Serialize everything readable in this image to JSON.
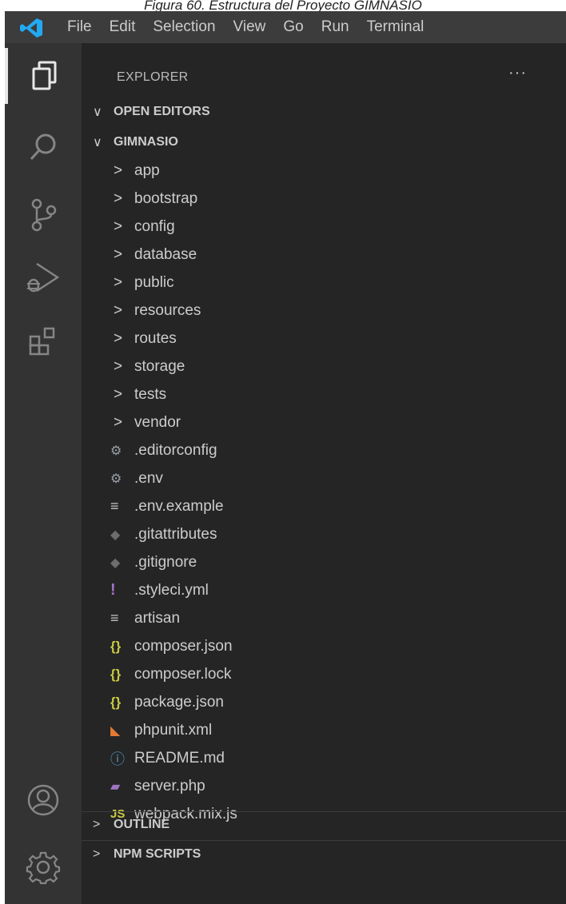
{
  "caption": "Figura 60. Estructura del Proyecto GIMNASIO",
  "menu": [
    "File",
    "Edit",
    "Selection",
    "View",
    "Go",
    "Run",
    "Terminal"
  ],
  "sidebar": {
    "title": "EXPLORER",
    "more": "···",
    "open_editors": "OPEN EDITORS",
    "project": "GIMNASIO",
    "folders": [
      "app",
      "bootstrap",
      "config",
      "database",
      "public",
      "resources",
      "routes",
      "storage",
      "tests",
      "vendor"
    ],
    "files": [
      {
        "name": ".editorconfig",
        "icon": "gear-icon"
      },
      {
        "name": ".env",
        "icon": "gear-icon"
      },
      {
        "name": ".env.example",
        "icon": "lines-icon"
      },
      {
        "name": ".gitattributes",
        "icon": "diamond-icon"
      },
      {
        "name": ".gitignore",
        "icon": "diamond-icon"
      },
      {
        "name": ".styleci.yml",
        "icon": "exclamation-icon"
      },
      {
        "name": "artisan",
        "icon": "lines-icon"
      },
      {
        "name": "composer.json",
        "icon": "braces-icon"
      },
      {
        "name": "composer.lock",
        "icon": "braces-icon"
      },
      {
        "name": "package.json",
        "icon": "braces-icon"
      },
      {
        "name": "phpunit.xml",
        "icon": "rss-icon"
      },
      {
        "name": "README.md",
        "icon": "info-icon"
      },
      {
        "name": "server.php",
        "icon": "php-elephant-icon"
      },
      {
        "name": "webpack.mix.js",
        "icon": "js-icon"
      }
    ],
    "outline": "OUTLINE",
    "npm_scripts": "NPM SCRIPTS"
  },
  "colors": {
    "sidebar_bg": "#252526",
    "activity_bg": "#333333",
    "menubar_bg": "#3c3c3c",
    "text": "#cccccc",
    "vscode_blue": "#23a9f2"
  }
}
